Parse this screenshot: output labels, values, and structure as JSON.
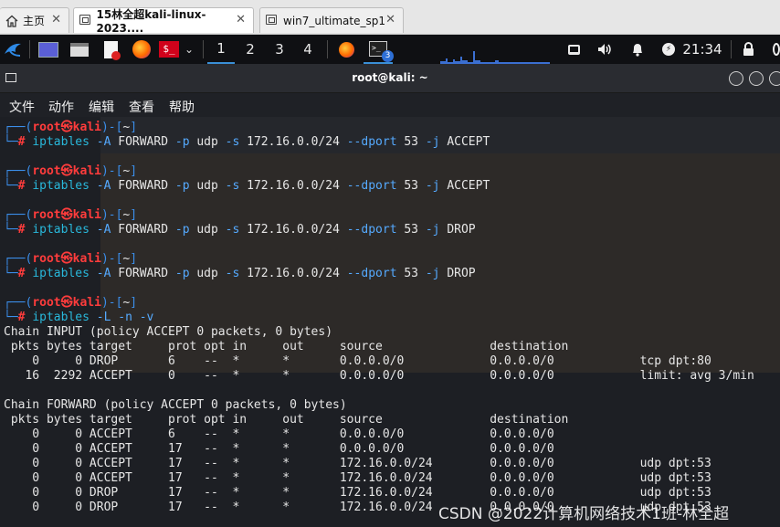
{
  "vm_tabs": [
    {
      "label": "主页",
      "icon": "home-icon",
      "active": false
    },
    {
      "label": "15林全超kali-linux-2023....",
      "icon": "vm-icon",
      "active": true
    },
    {
      "label": "win7_ultimate_sp1",
      "icon": "vm-icon",
      "active": false
    }
  ],
  "panel": {
    "workspaces": [
      "1",
      "2",
      "3",
      "4"
    ],
    "active_workspace": "1",
    "terminal_badge": "3",
    "clock": "21:34"
  },
  "terminal": {
    "title": "root@kali: ~",
    "menu": [
      "文件",
      "动作",
      "编辑",
      "查看",
      "帮助"
    ],
    "prompt": {
      "user": "root",
      "host": "kali",
      "dir": "~"
    },
    "blocks": [
      {
        "command": "iptables",
        "args": "-A FORWARD -p udp -s 172.16.0.0/24 --dport 53 -j ACCEPT"
      },
      {
        "command": "iptables",
        "args": "-A FORWARD -p udp -s 172.16.0.0/24 --dport 53 -j ACCEPT"
      },
      {
        "command": "iptables",
        "args": "-A FORWARD -p udp -s 172.16.0.0/24 --dport 53 -j DROP"
      },
      {
        "command": "iptables",
        "args": "-A FORWARD -p udp -s 172.16.0.0/24 --dport 53 -j DROP"
      },
      {
        "command": "iptables",
        "args": "-L -n -v"
      }
    ],
    "output": [
      "Chain INPUT (policy ACCEPT 0 packets, 0 bytes)",
      " pkts bytes target     prot opt in     out     source               destination         ",
      "    0     0 DROP       6    --  *      *       0.0.0.0/0            0.0.0.0/0            tcp dpt:80",
      "   16  2292 ACCEPT     0    --  *      *       0.0.0.0/0            0.0.0.0/0            limit: avg 3/min",
      "",
      "Chain FORWARD (policy ACCEPT 0 packets, 0 bytes)",
      " pkts bytes target     prot opt in     out     source               destination         ",
      "    0     0 ACCEPT     6    --  *      *       0.0.0.0/0            0.0.0.0/0",
      "    0     0 ACCEPT     17   --  *      *       0.0.0.0/0            0.0.0.0/0",
      "    0     0 ACCEPT     17   --  *      *       172.16.0.0/24        0.0.0.0/0            udp dpt:53",
      "    0     0 ACCEPT     17   --  *      *       172.16.0.0/24        0.0.0.0/0            udp dpt:53",
      "    0     0 DROP       17   --  *      *       172.16.0.0/24        0.0.0.0/0            udp dpt:53",
      "    0     0 DROP       17   --  *      *       172.16.0.0/24        0.0.0.0/0            udp dpt:53"
    ]
  },
  "watermark": "CSDN @2022计算机网络技术1班-林全超",
  "colors": {
    "accent": "#3b8eea",
    "prompt_red": "#ff3c3c",
    "terminal_bg": "#1d1f24"
  }
}
